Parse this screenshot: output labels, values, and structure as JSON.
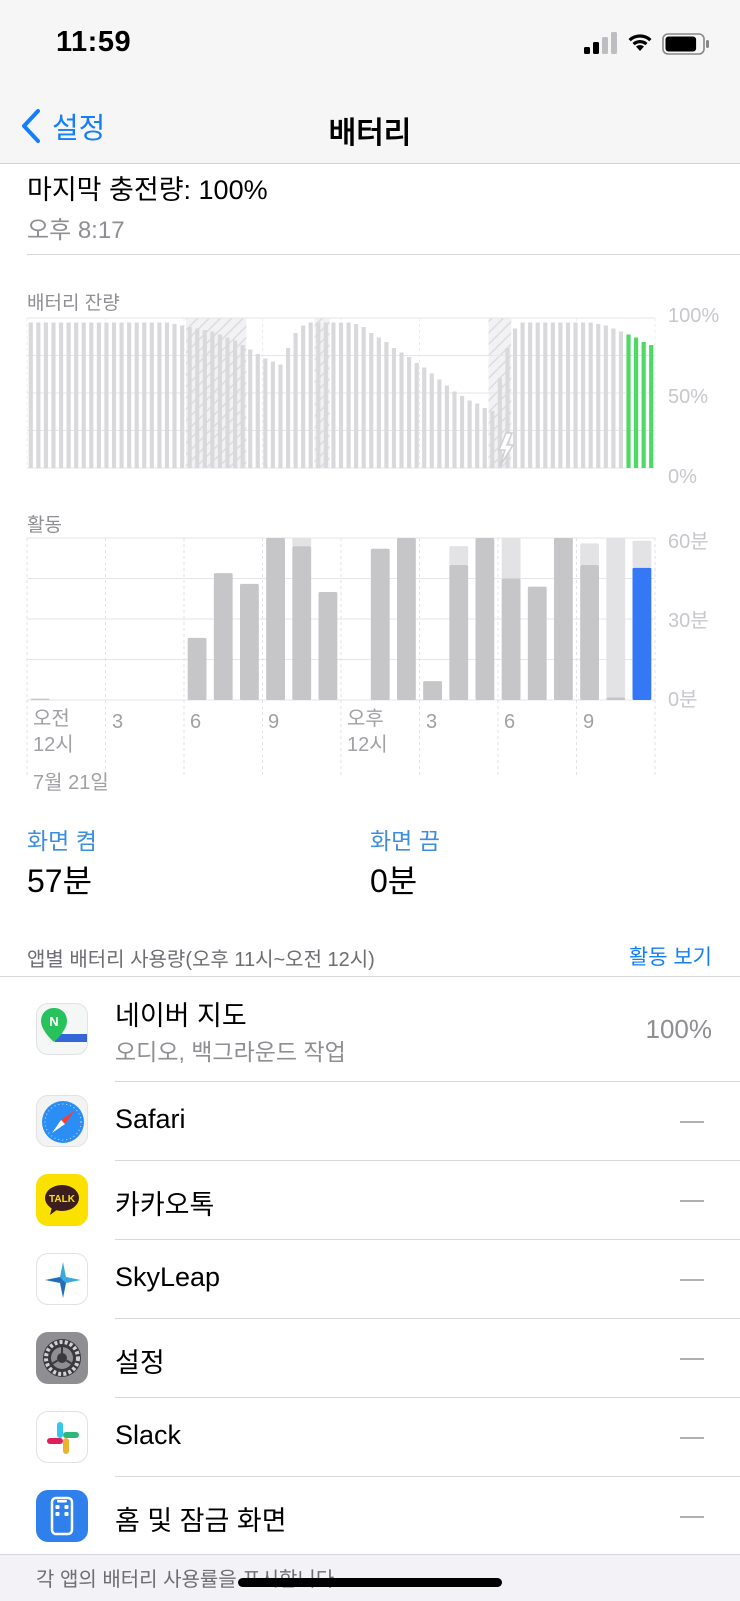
{
  "status_bar": {
    "time": "11:59",
    "signal_bars": 2,
    "battery_level": 0.85
  },
  "nav": {
    "back_label": "설정",
    "title": "배터리"
  },
  "last_charge": {
    "label": "마지막 충전량: 100%",
    "time": "오후 8:17"
  },
  "battery_chart": {
    "label": "배터리 잔량",
    "y_ticks": [
      "100%",
      "50%",
      "0%"
    ],
    "ylim": [
      0,
      100
    ],
    "charging_segments": [
      [
        21,
        29
      ],
      [
        38,
        40
      ],
      [
        61,
        64
      ]
    ],
    "green_bar_color": "#4cd964",
    "bar_color": "#d9d9dc",
    "values": [
      97,
      97,
      97,
      97,
      97,
      97,
      97,
      97,
      97,
      97,
      97,
      97,
      97,
      97,
      97,
      97,
      97,
      97,
      97,
      96,
      95,
      94,
      93,
      92,
      91,
      89,
      87,
      85,
      82,
      79,
      76,
      73,
      71,
      69,
      80,
      90,
      95,
      97,
      97,
      97,
      97,
      97,
      97,
      96,
      94,
      90,
      87,
      84,
      80,
      77,
      74,
      70,
      67,
      63,
      59,
      55,
      51,
      48,
      45,
      43,
      40,
      38,
      60,
      80,
      93,
      97,
      97,
      97,
      97,
      97,
      97,
      97,
      97,
      97,
      97,
      96,
      95,
      93,
      91,
      89,
      87,
      84,
      82
    ]
  },
  "chart_data": {
    "type": "bar",
    "title": "활동",
    "categories": [
      "0",
      "1",
      "2",
      "3",
      "4",
      "5",
      "6",
      "7",
      "8",
      "9",
      "10",
      "11",
      "12",
      "13",
      "14",
      "15",
      "16",
      "17",
      "18",
      "19",
      "20",
      "21",
      "22",
      "23"
    ],
    "series": [
      {
        "name": "화면 켬",
        "values": [
          0.5,
          0,
          0,
          0,
          0,
          0,
          23,
          47,
          43,
          60,
          57,
          40,
          0,
          56,
          60,
          7,
          50,
          60,
          45,
          42,
          60,
          50,
          1,
          49
        ]
      },
      {
        "name": "화면 끔",
        "values": [
          0,
          0,
          0,
          0,
          0,
          0,
          0,
          0,
          0,
          0,
          3,
          0,
          0,
          0,
          0,
          0,
          7,
          0,
          15,
          0,
          0,
          8,
          59,
          10
        ]
      }
    ],
    "y_ticks": [
      "60분",
      "30분",
      "0분"
    ],
    "ylim": [
      0,
      60
    ],
    "x_tick_labels": [
      "오전",
      "12시",
      "3",
      "6",
      "9",
      "오후",
      "12시",
      "3",
      "6",
      "9"
    ],
    "date": "7월 21일",
    "highlight_color": "#3478f6",
    "on_color": "#c6c6c8",
    "off_color": "#e3e3e5"
  },
  "screen_stats": {
    "on_label": "화면 켬",
    "on_value": "57분",
    "off_label": "화면 끔",
    "off_value": "0분"
  },
  "app_usage": {
    "title": "앱별 배터리 사용량(오후 11시~오전 12시)",
    "activity_link": "활동 보기",
    "apps": [
      {
        "name": "네이버 지도",
        "detail": "오디오, 백그라운드 작업",
        "percent": "100%",
        "icon": "naver-map-icon"
      },
      {
        "name": "Safari",
        "detail": "",
        "percent": "",
        "icon": "safari-icon"
      },
      {
        "name": "카카오톡",
        "detail": "",
        "percent": "",
        "icon": "kakaotalk-icon",
        "icon_text": "TALK"
      },
      {
        "name": "SkyLeap",
        "detail": "",
        "percent": "",
        "icon": "skyleap-icon"
      },
      {
        "name": "설정",
        "detail": "",
        "percent": "",
        "icon": "settings-icon"
      },
      {
        "name": "Slack",
        "detail": "",
        "percent": "",
        "icon": "slack-icon"
      },
      {
        "name": "홈 및 잠금 화면",
        "detail": "",
        "percent": "",
        "icon": "home-lock-screen-icon"
      }
    ],
    "footer": "각 앱의 배터리 사용률을 표시합니다."
  }
}
